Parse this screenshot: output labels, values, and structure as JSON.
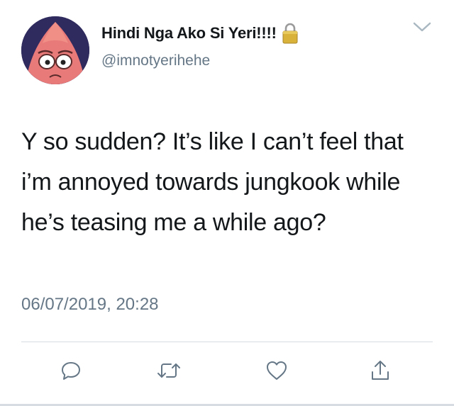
{
  "tweet": {
    "author": {
      "display_name": "Hindi Nga Ako Si Yeri!!!!",
      "handle": "@imnotyerihehe",
      "protected_icon": "lock-icon",
      "avatar_description": "avatar"
    },
    "text": "Y so sudden? It’s like I can’t feel that i’m annoyed towards jungkook while he’s teasing me a while ago?",
    "timestamp": "06/07/2019, 20:28",
    "menu_icon": "chevron-down-icon",
    "actions": [
      {
        "name": "reply",
        "icon": "reply-icon"
      },
      {
        "name": "retweet",
        "icon": "retweet-icon"
      },
      {
        "name": "like",
        "icon": "heart-icon"
      },
      {
        "name": "share",
        "icon": "share-icon"
      }
    ]
  },
  "colors": {
    "text_primary": "#14171a",
    "text_secondary": "#657786",
    "divider": "#d6dce1",
    "lock": "#c9a227"
  }
}
